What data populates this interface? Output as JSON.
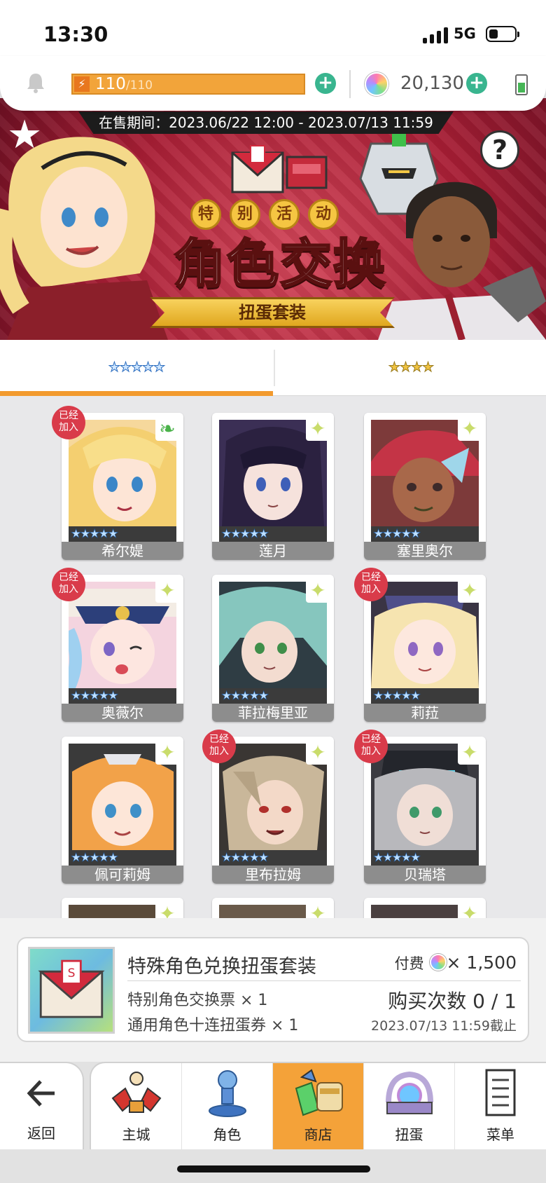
{
  "status_bar": {
    "time": "13:30",
    "network": "5G"
  },
  "resources": {
    "stamina": "110",
    "stamina_max": "/110",
    "gems": "20,130"
  },
  "banner": {
    "sale_period": "在售期间：2023.06/22 12:00 - 2023.07/13 11:59",
    "event_chars": [
      "特",
      "别",
      "活",
      "动"
    ],
    "title": "角色交换",
    "subtitle": "扭蛋套装",
    "help_glyph": "?"
  },
  "tabs": [
    {
      "label": "★★★★★",
      "active": true
    },
    {
      "label": "★★★★",
      "active": false
    }
  ],
  "characters": [
    {
      "name": "希尔媞",
      "rarity": "★★★★★",
      "joined": true,
      "leaf": true
    },
    {
      "name": "莲月",
      "rarity": "★★★★★",
      "joined": false
    },
    {
      "name": "塞里奥尔",
      "rarity": "★★★★★",
      "joined": false
    },
    {
      "name": "奥薇尔",
      "rarity": "★★★★★",
      "joined": true
    },
    {
      "name": "菲拉梅里亚",
      "rarity": "★★★★★",
      "joined": false
    },
    {
      "name": "莉菈",
      "rarity": "★★★★★",
      "joined": true
    },
    {
      "name": "佩可莉姆",
      "rarity": "★★★★★",
      "joined": false
    },
    {
      "name": "里布拉姆",
      "rarity": "★★★★★",
      "joined": true
    },
    {
      "name": "贝瑞塔",
      "rarity": "★★★★★",
      "joined": true
    }
  ],
  "joined_badge": "已经加入",
  "joined_line1": "已经",
  "joined_line2": "加入",
  "product": {
    "title": "特殊角色兑换扭蛋套装",
    "item1": "特别角色交换票 × 1",
    "item2": "通用角色十连扭蛋券 × 1",
    "price_label": "付费",
    "price": "× 1,500",
    "purchase_count": "购买次数 0 / 1",
    "deadline": "2023.07/13 11:59截止"
  },
  "nav": {
    "back": "返回",
    "items": [
      {
        "label": "主城"
      },
      {
        "label": "角色"
      },
      {
        "label": "商店",
        "active": true
      },
      {
        "label": "扭蛋"
      },
      {
        "label": "菜单"
      }
    ]
  },
  "colors": {
    "accent": "#f29a2e",
    "plus_button": "#39b58f",
    "badge": "#d93b4a"
  },
  "icons": [
    "bell-icon",
    "lightning-icon",
    "plus-icon",
    "gem-icon",
    "battery-icon",
    "help-icon",
    "back-arrow-icon",
    "castle-icon",
    "character-icon",
    "shop-icon",
    "gacha-icon",
    "menu-icon"
  ]
}
